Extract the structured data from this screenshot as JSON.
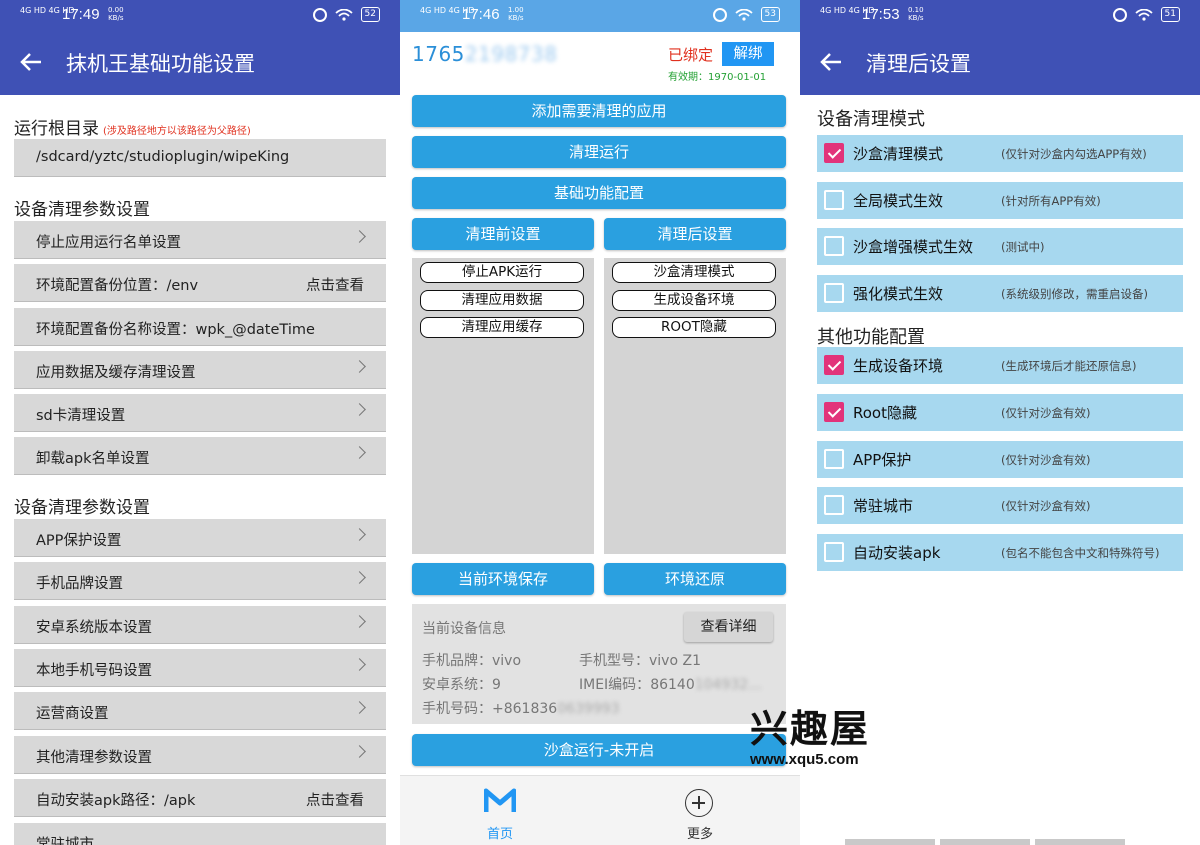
{
  "screen1": {
    "status": {
      "net": "4G HD 4G HD",
      "time": "17:49",
      "speed_top": "0.00",
      "speed_bottom": "KB/s",
      "battery": "52"
    },
    "title": "抹机王基础功能设置",
    "root_label": "运行根目录",
    "root_note": "(涉及路径地方以该路径为父路径)",
    "root_path": "/sdcard/yztc/studioplugin/wipeKing",
    "section1": "设备清理参数设置",
    "items1": [
      {
        "label": "停止应用运行名单设置",
        "right": ""
      },
      {
        "label": "环境配置备份位置：/env",
        "right": "点击查看"
      },
      {
        "label": "环境配置备份名称设置：wpk_@dateTime",
        "right": ""
      },
      {
        "label": "应用数据及缓存清理设置",
        "right": ""
      },
      {
        "label": "sd卡清理设置",
        "right": ""
      },
      {
        "label": "卸载apk名单设置",
        "right": ""
      }
    ],
    "section2": "设备清理参数设置",
    "items2": [
      {
        "label": "APP保护设置",
        "right": ""
      },
      {
        "label": "手机品牌设置",
        "right": ""
      },
      {
        "label": "安卓系统版本设置",
        "right": ""
      },
      {
        "label": "本地手机号码设置",
        "right": ""
      },
      {
        "label": "运营商设置",
        "right": ""
      },
      {
        "label": "其他清理参数设置",
        "right": ""
      },
      {
        "label": "自动安装apk路径：/apk",
        "right": "点击查看"
      },
      {
        "label": "常驻城市",
        "right": ""
      }
    ]
  },
  "screen2": {
    "status": {
      "net": "4G HD 4G HD",
      "time": "17:46",
      "speed_top": "1.00",
      "speed_bottom": "KB/s",
      "battery": "53"
    },
    "phone_visible": "1765",
    "phone_hidden": "2198738",
    "bound": "已绑定",
    "unbind": "解绑",
    "valid": "有效期：1970-01-01",
    "btn_add": "添加需要清理的应用",
    "btn_clean": "清理运行",
    "btn_basic": "基础功能配置",
    "btn_pre": "清理前设置",
    "btn_post": "清理后设置",
    "pre_chips": [
      "停止APK运行",
      "清理应用数据",
      "清理应用缓存"
    ],
    "post_chips": [
      "沙盒清理模式",
      "生成设备环境",
      "ROOT隐藏"
    ],
    "btn_save": "当前环境保存",
    "btn_restore": "环境还原",
    "info_title": "当前设备信息",
    "info_detail": "查看详细",
    "brand": "手机品牌：vivo",
    "model": "手机型号：vivo Z1",
    "android": "安卓系统：9",
    "imei_label": "IMEI编码：",
    "imei_visible": "86140",
    "imei_hidden": "104932…",
    "phone_label": "手机号码：",
    "phone_num_visible": "+861836",
    "phone_num_hidden": "0639993",
    "btn_sandbox": "沙盒运行-未开启",
    "nav_home": "首页",
    "nav_more": "更多",
    "accent": "#2aa0e0"
  },
  "screen3": {
    "status": {
      "net": "4G HD 4G HD",
      "time": "17:53",
      "speed_top": "0.10",
      "speed_bottom": "KB/s",
      "battery": "51"
    },
    "title": "清理后设置",
    "section1": "设备清理模式",
    "mode_items": [
      {
        "name": "沙盒清理模式",
        "note": "(仅针对沙盒内勾选APP有效)",
        "checked": true
      },
      {
        "name": "全局模式生效",
        "note": "(针对所有APP有效)",
        "checked": false
      },
      {
        "name": "沙盒增强模式生效",
        "note": "(测试中)",
        "checked": false
      },
      {
        "name": "强化模式生效",
        "note": "(系统级别修改，需重启设备)",
        "checked": false
      }
    ],
    "section2": "其他功能配置",
    "other_items": [
      {
        "name": "生成设备环境",
        "note": "(生成环境后才能还原信息)",
        "checked": true
      },
      {
        "name": "Root隐藏",
        "note": "(仅针对沙盒有效)",
        "checked": true
      },
      {
        "name": "APP保护",
        "note": "(仅针对沙盒有效)",
        "checked": false
      },
      {
        "name": "常驻城市",
        "note": "(仅针对沙盒有效)",
        "checked": false
      },
      {
        "name": "自动安装apk",
        "note": "(包名不能包含中文和特殊符号)",
        "checked": false
      }
    ]
  },
  "watermark": {
    "logo": "兴趣屋",
    "url": "www.xqu5.com"
  }
}
